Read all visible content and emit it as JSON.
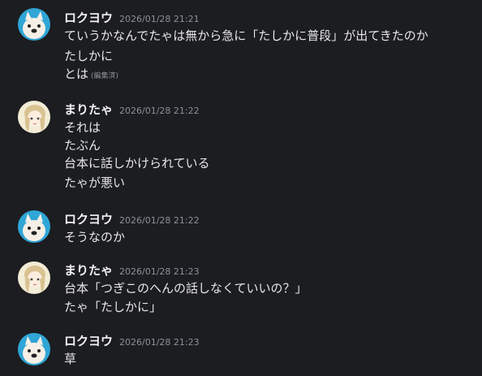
{
  "messages": [
    {
      "username": "ロクヨウ",
      "avatar_icon": "dog-avatar-icon",
      "timestamp": "2026/01/28 21:21",
      "lines": [
        "ていうかなんでたゃは無から急に「たしかに普段」が出てきたのか",
        "たしかに",
        "とは"
      ],
      "edited_label": "(編集済)"
    },
    {
      "username": "まりたゃ",
      "avatar_icon": "girl-avatar-icon",
      "timestamp": "2026/01/28 21:22",
      "lines": [
        "それは",
        "たぶん",
        "台本に話しかけられている",
        "たゃが悪い"
      ]
    },
    {
      "username": "ロクヨウ",
      "avatar_icon": "dog-avatar-icon",
      "timestamp": "2026/01/28 21:22",
      "lines": [
        "そうなのか"
      ]
    },
    {
      "username": "まりたゃ",
      "avatar_icon": "girl-avatar-icon",
      "timestamp": "2026/01/28 21:23",
      "lines": [
        "台本「つぎこのへんの話しなくていいの？」",
        "たゃ「たしかに」"
      ]
    },
    {
      "username": "ロクヨウ",
      "avatar_icon": "dog-avatar-icon",
      "timestamp": "2026/01/28 21:23",
      "lines": [
        "草"
      ]
    }
  ],
  "colors": {
    "background": "#1c1d21",
    "username": "#f2f2f4",
    "timestamp": "#8e9098",
    "text": "#e6e6e9",
    "dog_avatar_bg": "#2fa6d6",
    "girl_avatar_bg": "#f3ecd6"
  }
}
